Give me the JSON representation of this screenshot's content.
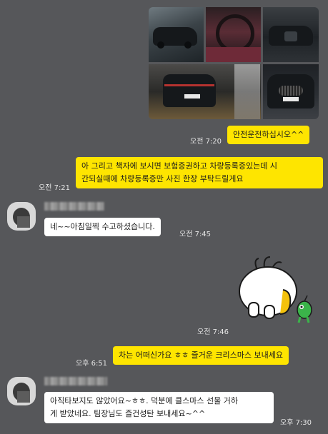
{
  "messages": [
    {
      "id": "photo-grid",
      "from": "me",
      "type": "photo_grid",
      "photo_count": 5,
      "description": "car photos"
    },
    {
      "id": "m1",
      "from": "me",
      "text": "안전운전하십시오^^",
      "time": "오전 7:20"
    },
    {
      "id": "m2",
      "from": "me",
      "text": "아 그리고 책자에 보시면 보험증권하고 차량등록증있는데 시간되실때에 차량등록증만 사진 한장 부탁드릴게요",
      "line1": "아 그리고 책자에 보시면 보험증권하고 차량등록증있는데 시",
      "line2": "간되실때에 차량등록증만 사진 한장 부탁드릴게요",
      "time": "오전 7:21"
    },
    {
      "id": "m3",
      "from": "other",
      "text": "네~~아침일찍 수고하셨습니다.",
      "time": "오전 7:45"
    },
    {
      "id": "m4",
      "from": "me",
      "type": "sticker",
      "sticker": "white-creature-and-green-alien",
      "time": "오전 7:46"
    },
    {
      "id": "m5",
      "from": "me",
      "text": "차는 어떠신가요 ㅎㅎ 즐거운 크리스마스 보내세요",
      "time": "오후 6:51"
    },
    {
      "id": "m6",
      "from": "other",
      "text": "아직타보지도 않았어요~ㅎㅎ. 덕분에 클스마스 선물 거하게 받았네요. 팀장님도 즐건성탄 보내세요~^^",
      "line1": "아직타보지도 않았어요~ㅎㅎ. 덕분에 클스마스 선물 거하",
      "line2": "게 받았네요. 팀장님도 즐건성탄 보내세요~^^",
      "time": "오후 7:30"
    }
  ],
  "colors": {
    "background": "#56575a",
    "my_bubble": "#fee500",
    "other_bubble": "#ffffff"
  }
}
